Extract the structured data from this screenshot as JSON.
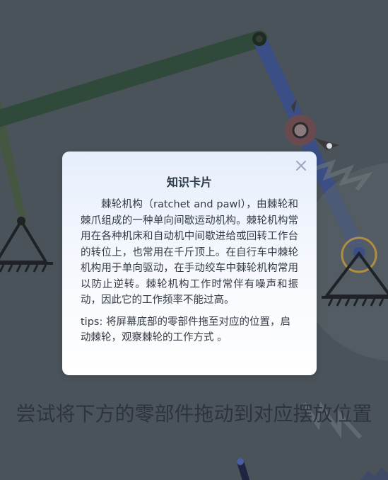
{
  "background": {
    "color": "#4a535a",
    "link_color": "#2f4a3a",
    "rod_color": "#3b4f86",
    "hub_color": "#6b4a4f",
    "pivot_color": "#d9a233"
  },
  "knowledge_card": {
    "title": "知识卡片",
    "close_icon": "close-icon",
    "paragraph": "棘轮机构（ratchet and pawl），由棘轮和棘爪组成的一种单向间歇运动机构。棘轮机构常用在各种机床和自动机中间歇进给或回转工作台的转位上，也常用在千斤顶上。在自行车中棘轮机构用于单向驱动，在手动绞车中棘轮机构常用以防止逆转。棘轮机构工作时常伴有噪声和振动，因此它的工作频率不能过高。",
    "tips": "tips: 将屏幕底部的零部件拖至对应的位置，启动棘轮，观察棘轮的工作方式 。"
  },
  "instruction": {
    "text": "尝试将下方的零部件拖动到对应摆放位置"
  }
}
